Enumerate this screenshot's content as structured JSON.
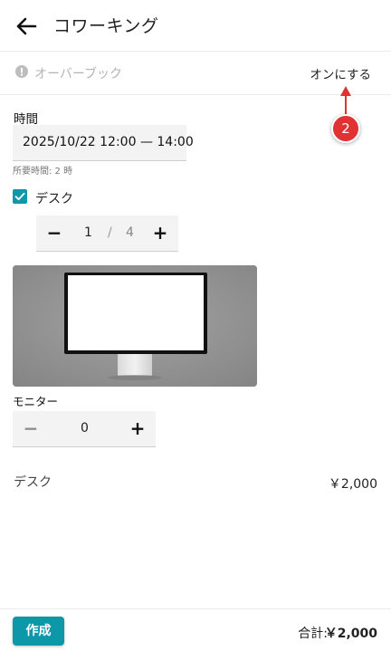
{
  "header": {
    "title": "コワーキング",
    "back_icon": "arrow-back-icon"
  },
  "overbook": {
    "label": "オーバーブック",
    "action": "オンにする",
    "icon": "info-icon"
  },
  "annotation": {
    "step": "2",
    "color": "#e03232"
  },
  "time": {
    "label": "時間",
    "value": "2025/10/22 12:00 — 14:00",
    "duration": "所要時間: 2 時"
  },
  "desk": {
    "label": "デスク",
    "checked": true,
    "quantity": "1",
    "separator": "/",
    "max": "4"
  },
  "monitor": {
    "label": "モニター",
    "quantity": "0"
  },
  "summary": {
    "item_label": "デスク",
    "item_price": "￥2,000"
  },
  "footer": {
    "create_label": "作成",
    "total_label": "合計:",
    "total_value": "￥2,000"
  },
  "colors": {
    "accent": "#0c98a8",
    "muted": "#b3b3b3"
  }
}
